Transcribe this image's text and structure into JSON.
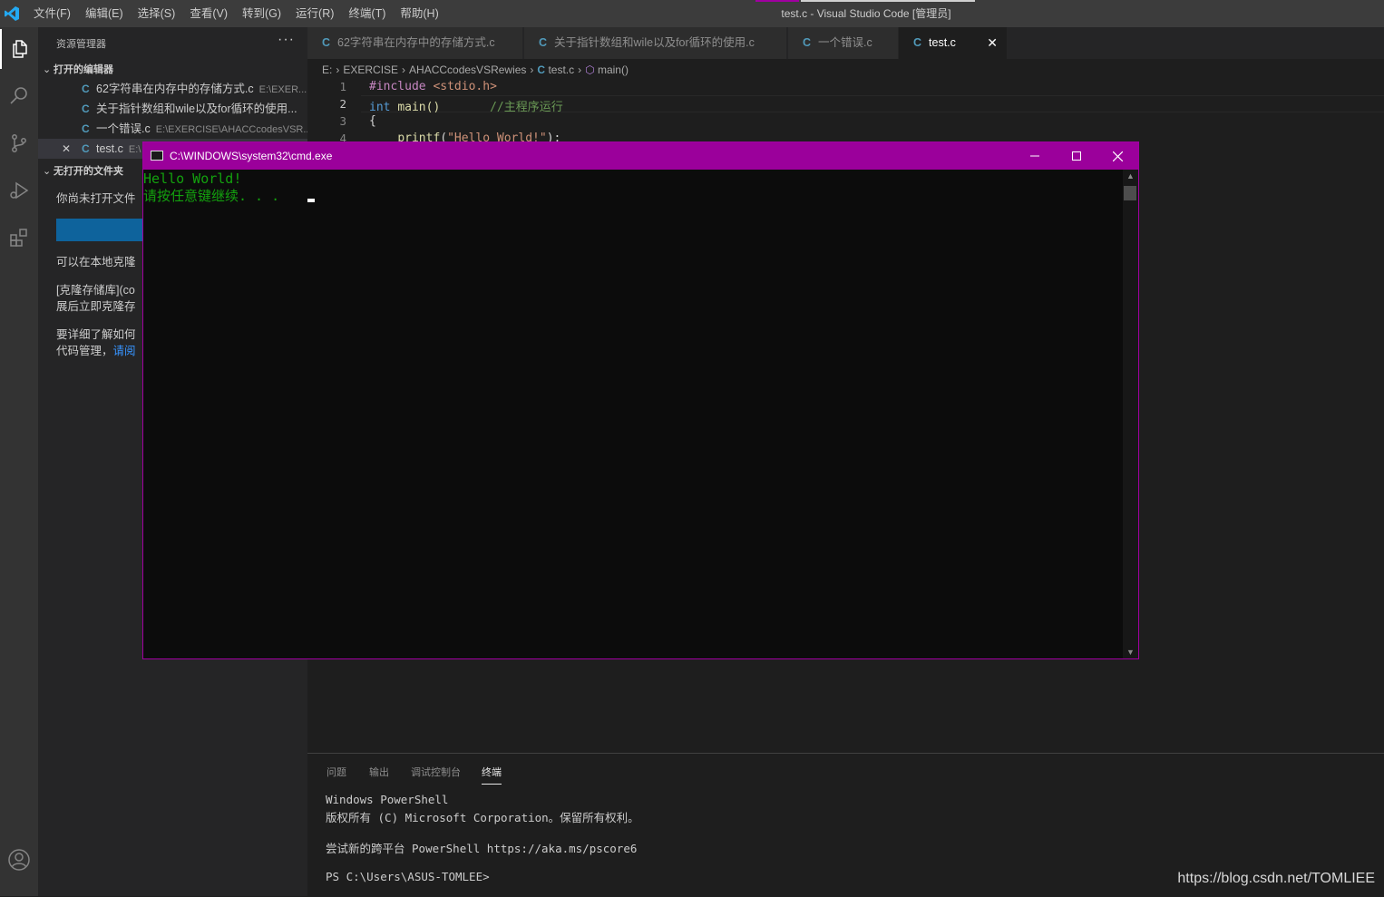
{
  "titlebar": {
    "menu": [
      "文件(F)",
      "编辑(E)",
      "选择(S)",
      "查看(V)",
      "转到(G)",
      "运行(R)",
      "终端(T)",
      "帮助(H)"
    ],
    "title": "test.c - Visual Studio Code [管理员]"
  },
  "sidebar": {
    "header": "资源管理器",
    "more": "···",
    "open_editors_title": "打开的编辑器",
    "open_editors": [
      {
        "name": "62字符串在内存中的存储方式.c",
        "path": "E:\\EXER..."
      },
      {
        "name": "关于指针数组和wile以及for循环的使用...",
        "path": ""
      },
      {
        "name": "一个错误.c",
        "path": "E:\\EXERCISE\\AHACCcodesVSR..."
      },
      {
        "name": "test.c",
        "path": "E:\\"
      }
    ],
    "no_folder_title": "无打开的文件夹",
    "msg1": "你尚未打开文件",
    "msg2": "可以在本地克隆",
    "msg3a": "[克隆存储库](co",
    "msg3b": "展后立即克隆存",
    "msg4a": "要详细了解如何",
    "msg4b": "代码管理，",
    "msg4_link": "请阅"
  },
  "tabs": [
    {
      "label": "62字符串在内存中的存储方式.c"
    },
    {
      "label": "关于指针数组和wile以及for循环的使用.c"
    },
    {
      "label": "一个错误.c"
    },
    {
      "label": "test.c"
    }
  ],
  "breadcrumb": {
    "parts": [
      "E:",
      "EXERCISE",
      "AHACCcodesVSRewies"
    ],
    "file": "test.c",
    "symbol": "main()"
  },
  "code": {
    "line_numbers": [
      "1",
      "2",
      "3",
      "4"
    ],
    "l1_directive": "#include",
    "l1_header": "<stdio.h>",
    "l2_type": "int",
    "l2_fn": "main()",
    "l2_comment": "//主程序运行",
    "l3": "{",
    "l4_fn": "printf",
    "l4_str": "\"Hello World!\"",
    "l4_end": ");"
  },
  "cmd": {
    "title": "C:\\WINDOWS\\system32\\cmd.exe",
    "line1": "Hello World!",
    "line2": "请按任意键继续. . ."
  },
  "panel": {
    "tabs": [
      "问题",
      "输出",
      "调试控制台",
      "终端"
    ],
    "active_tab": "终端",
    "terminal": [
      "Windows PowerShell",
      "版权所有 (C) Microsoft Corporation。保留所有权利。",
      "",
      "尝试新的跨平台 PowerShell https://aka.ms/pscore6",
      "",
      "PS C:\\Users\\ASUS-TOMLEE>"
    ]
  },
  "watermark": "https://blog.csdn.net/TOMLIEE",
  "colors": {
    "cmd_titlebar": "#9b009b",
    "cmd_text": "#13a10e",
    "c_icon": "#519aba",
    "button": "#0e639c"
  }
}
